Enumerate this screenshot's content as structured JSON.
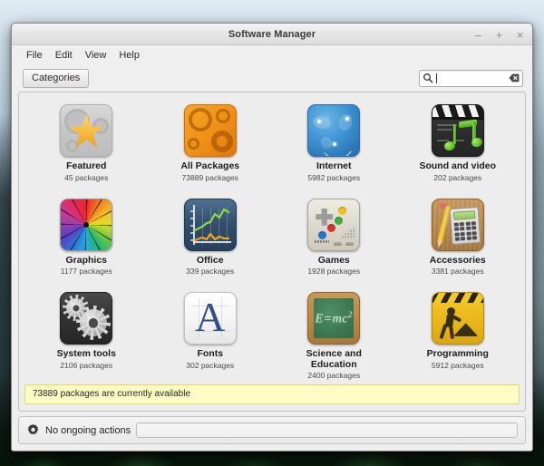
{
  "window": {
    "title": "Software Manager",
    "controls": [
      {
        "name": "minimize",
        "glyph": "–"
      },
      {
        "name": "maximize",
        "glyph": "+"
      },
      {
        "name": "close",
        "glyph": "×"
      }
    ]
  },
  "menubar": {
    "items": [
      {
        "label": "File"
      },
      {
        "label": "Edit"
      },
      {
        "label": "View"
      },
      {
        "label": "Help"
      }
    ]
  },
  "toolbar": {
    "categories_label": "Categories",
    "search": {
      "value": "",
      "placeholder": "",
      "icon": "search-icon",
      "clear_icon": "clear-icon"
    }
  },
  "categories": [
    {
      "label": "Featured",
      "count": "45 packages",
      "icon": "featured-icon"
    },
    {
      "label": "All Packages",
      "count": "73889 packages",
      "icon": "all-packages-icon"
    },
    {
      "label": "Internet",
      "count": "5982 packages",
      "icon": "internet-icon"
    },
    {
      "label": "Sound and video",
      "count": "202 packages",
      "icon": "sound-and-video-icon"
    },
    {
      "label": "Graphics",
      "count": "1177 packages",
      "icon": "graphics-icon"
    },
    {
      "label": "Office",
      "count": "339 packages",
      "icon": "office-icon"
    },
    {
      "label": "Games",
      "count": "1928 packages",
      "icon": "games-icon"
    },
    {
      "label": "Accessories",
      "count": "3381 packages",
      "icon": "accessories-icon"
    },
    {
      "label": "System tools",
      "count": "2106 packages",
      "icon": "system-tools-icon"
    },
    {
      "label": "Fonts",
      "count": "302 packages",
      "icon": "fonts-icon"
    },
    {
      "label": "Science and Education",
      "count": "2400 packages",
      "icon": "science-and-education-icon"
    },
    {
      "label": "Programming",
      "count": "5912 packages",
      "icon": "programming-icon"
    }
  ],
  "notification": {
    "text": "73889 packages are currently available"
  },
  "statusbar": {
    "label": "No ongoing actions",
    "icon": "gear-icon",
    "progress": "0"
  },
  "icon_art": {
    "fonts_letter": "A",
    "science_formula_base": "E=mc",
    "science_formula_exp": "2"
  },
  "colors": {
    "notification_bg": "#fcfcc4",
    "notification_border": "#e3d86a",
    "window_bg": "#efefef",
    "content_bg": "#ededed",
    "title_text": "#3a3a3a"
  }
}
